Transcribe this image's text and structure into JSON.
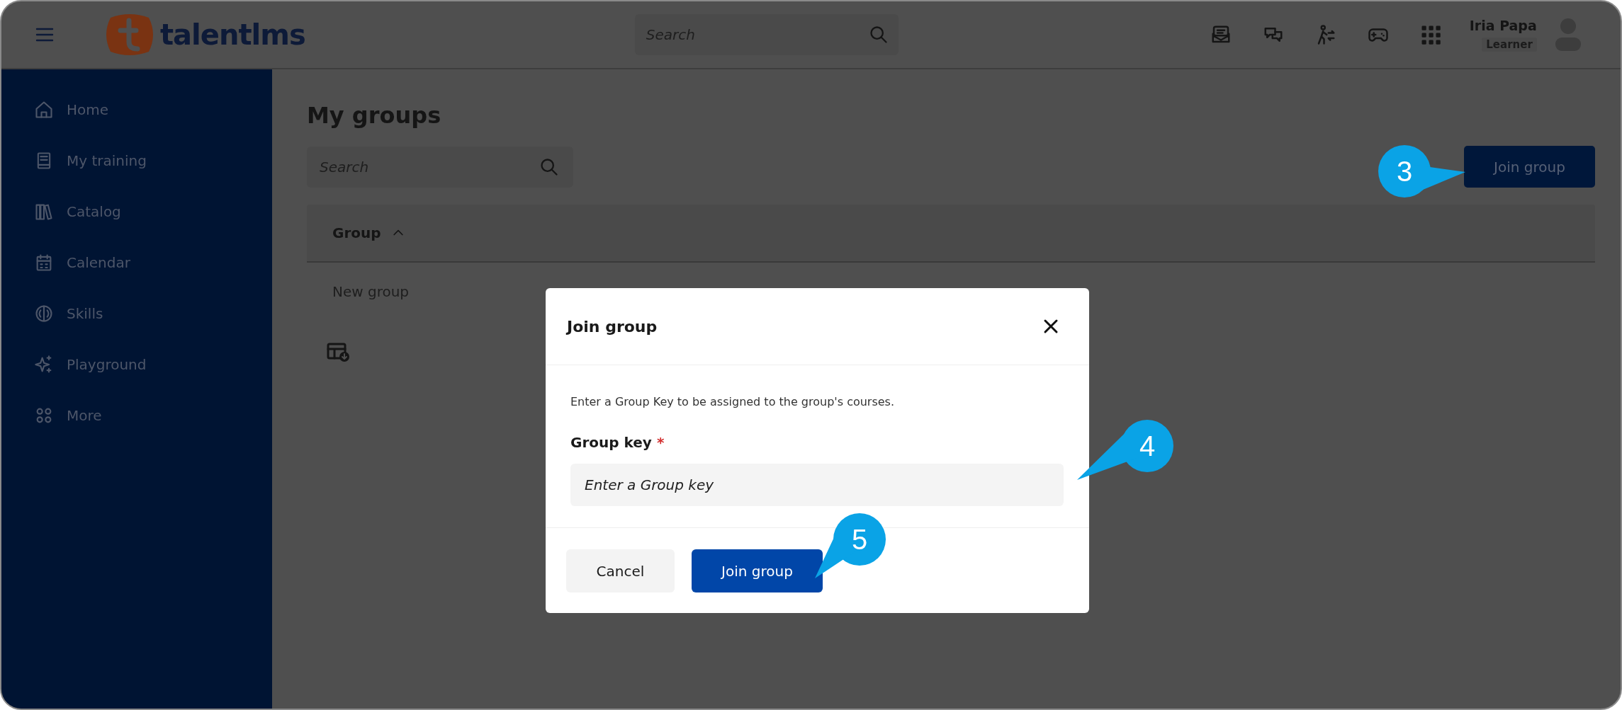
{
  "topbar": {
    "brand": "talentlms",
    "search": {
      "placeholder": "Search"
    },
    "user": {
      "name": "Iria Papa",
      "role": "Learner"
    }
  },
  "sidebar": {
    "items": [
      {
        "label": "Home"
      },
      {
        "label": "My training"
      },
      {
        "label": "Catalog"
      },
      {
        "label": "Calendar"
      },
      {
        "label": "Skills"
      },
      {
        "label": "Playground"
      },
      {
        "label": "More"
      }
    ]
  },
  "page": {
    "title": "My groups",
    "search": {
      "placeholder": "Search"
    },
    "join_button": "Join group",
    "table": {
      "columns": [
        {
          "label": "Group",
          "sort_ascending": true
        }
      ],
      "rows": [
        [
          "New group"
        ]
      ]
    }
  },
  "dialog": {
    "title": "Join group",
    "description": "Enter a Group Key to be assigned to the group's courses.",
    "field": {
      "label": "Group key",
      "required_mark": "*",
      "placeholder": "Enter a Group key"
    },
    "buttons": [
      {
        "label": "Cancel",
        "kind": "secondary"
      },
      {
        "label": "Join group",
        "kind": "primary"
      }
    ]
  },
  "callouts": [
    {
      "label": "3"
    },
    {
      "label": "4"
    },
    {
      "label": "5"
    }
  ]
}
